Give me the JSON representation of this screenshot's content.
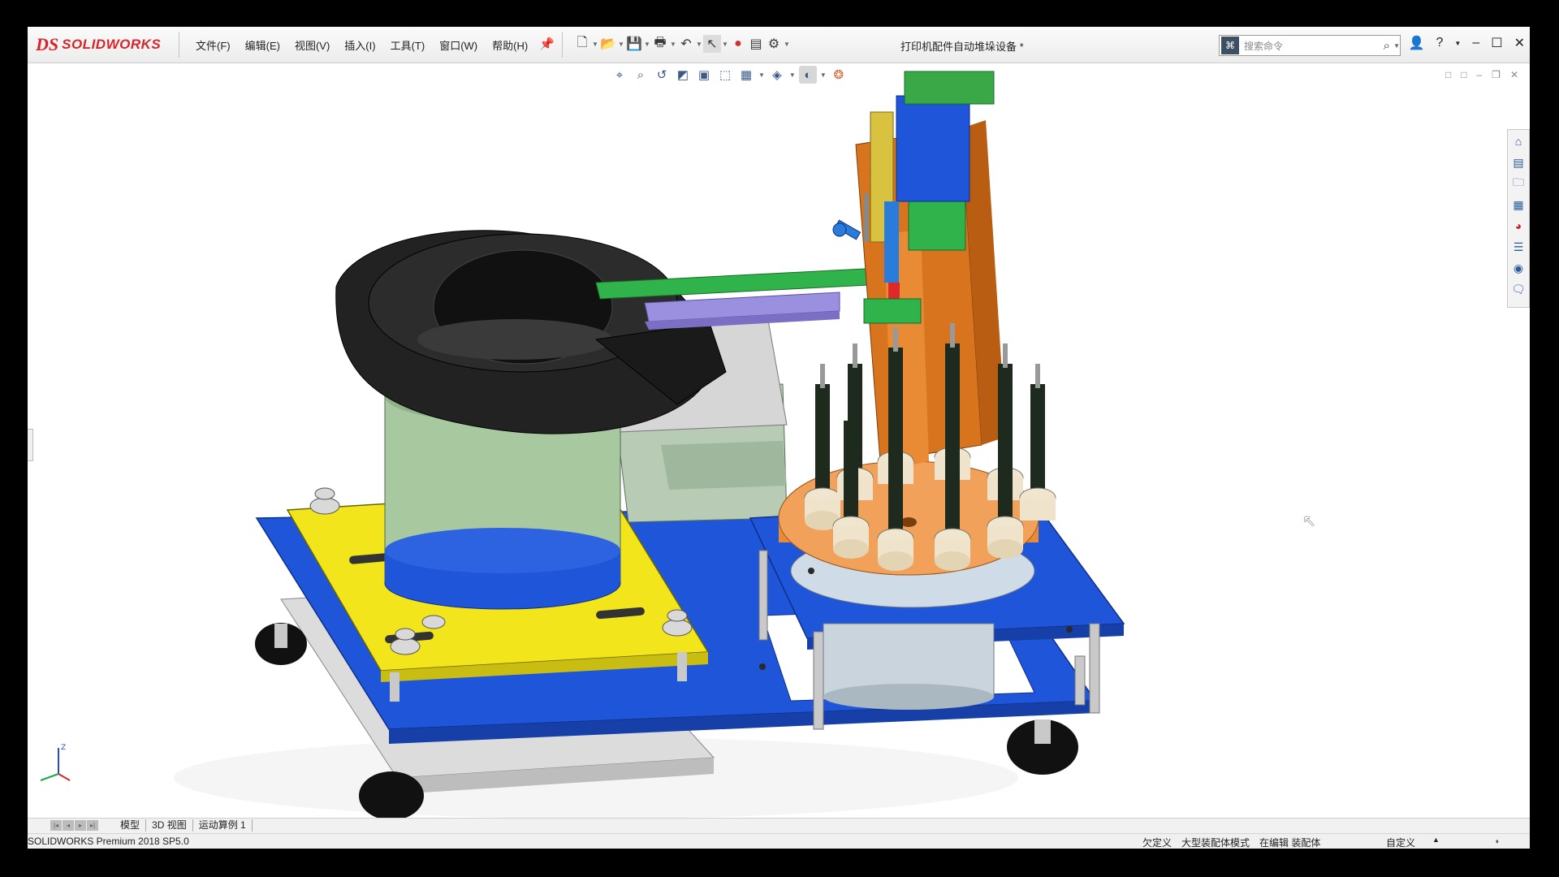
{
  "app": {
    "logo_ds": "DS",
    "logo_text": "SOLIDWORKS"
  },
  "menu": [
    "文件(F)",
    "编辑(E)",
    "视图(V)",
    "插入(I)",
    "工具(T)",
    "窗口(W)",
    "帮助(H)"
  ],
  "document_title": "打印机配件自动堆垛设备 *",
  "search": {
    "placeholder": "搜索命令"
  },
  "tabs": [
    "模型",
    "3D 视图",
    "运动算例 1"
  ],
  "status": {
    "product": "SOLIDWORKS Premium 2018 SP5.0",
    "items": [
      "欠定义",
      "大型装配体模式",
      "在编辑 装配体"
    ],
    "custom": "自定义",
    "arrow": "▲"
  },
  "icons": {
    "pin": "pin-icon",
    "window": [
      "user-icon",
      "help-icon",
      "minimize-icon",
      "maximize-icon",
      "close-icon"
    ]
  },
  "colors": {
    "brand_red": "#d7262b",
    "base_blue": "#1f55d8",
    "plate_yellow": "#f2e51c",
    "bowl_black": "#222222",
    "column_orange": "#d9741e",
    "turntable_orange": "#f2a15b",
    "drum_green": "#a8c8a0"
  }
}
